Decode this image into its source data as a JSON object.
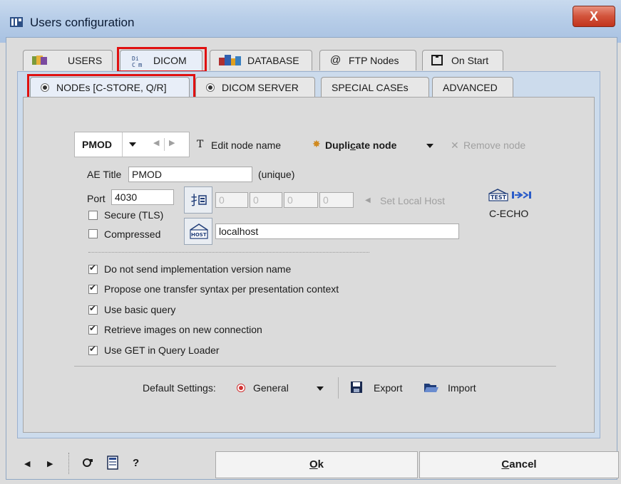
{
  "window": {
    "title": "Users configuration",
    "close_label": "X"
  },
  "main_tabs": [
    {
      "label": "USERS",
      "icon": "users-icon"
    },
    {
      "label": "DICOM",
      "icon": "dicom-icon",
      "active": true,
      "highlighted": true
    },
    {
      "label": "DATABASE",
      "icon": "database-icon"
    },
    {
      "label": "FTP Nodes",
      "icon": "at-icon"
    },
    {
      "label": "On Start",
      "icon": "window-icon"
    }
  ],
  "sub_tabs": [
    {
      "label": "NODEs [C-STORE, Q/R]",
      "active": true,
      "highlighted": true
    },
    {
      "label": "DICOM SERVER"
    },
    {
      "label": "SPECIAL CASEs"
    },
    {
      "label": "ADVANCED"
    }
  ],
  "node_toolbar": {
    "selected_node": "PMOD",
    "edit_label": "Edit node name",
    "duplicate_label": "Duplicate node",
    "remove_label": "Remove node"
  },
  "node_form": {
    "ae_title_label": "AE Title",
    "ae_title_value": "PMOD",
    "unique_label": "(unique)",
    "port_label": "Port",
    "port_value": "4030",
    "secure_label": "Secure (TLS)",
    "compressed_label": "Compressed",
    "ip": [
      "0",
      "0",
      "0",
      "0"
    ],
    "set_local_host_label": "Set Local Host",
    "host_value": "localhost",
    "echo_label": "C-ECHO",
    "echo_icon_text": "TEST"
  },
  "options": [
    {
      "label": "Do not send implementation version name",
      "checked": true
    },
    {
      "label": "Propose one transfer syntax per presentation context",
      "checked": true
    },
    {
      "label": "Use basic query",
      "checked": true
    },
    {
      "label": "Retrieve images on new connection",
      "checked": true
    },
    {
      "label": "Use GET in Query Loader",
      "checked": true
    }
  ],
  "defaults": {
    "label": "Default Settings:",
    "selected": "General",
    "export_label": "Export",
    "import_label": "Import"
  },
  "footer": {
    "ok_label": "Ok",
    "cancel_label": "Cancel",
    "help_label": "?"
  },
  "colors": {
    "highlight": "#e01010",
    "title_bar": "#b7cde8",
    "close": "#c2341d"
  }
}
